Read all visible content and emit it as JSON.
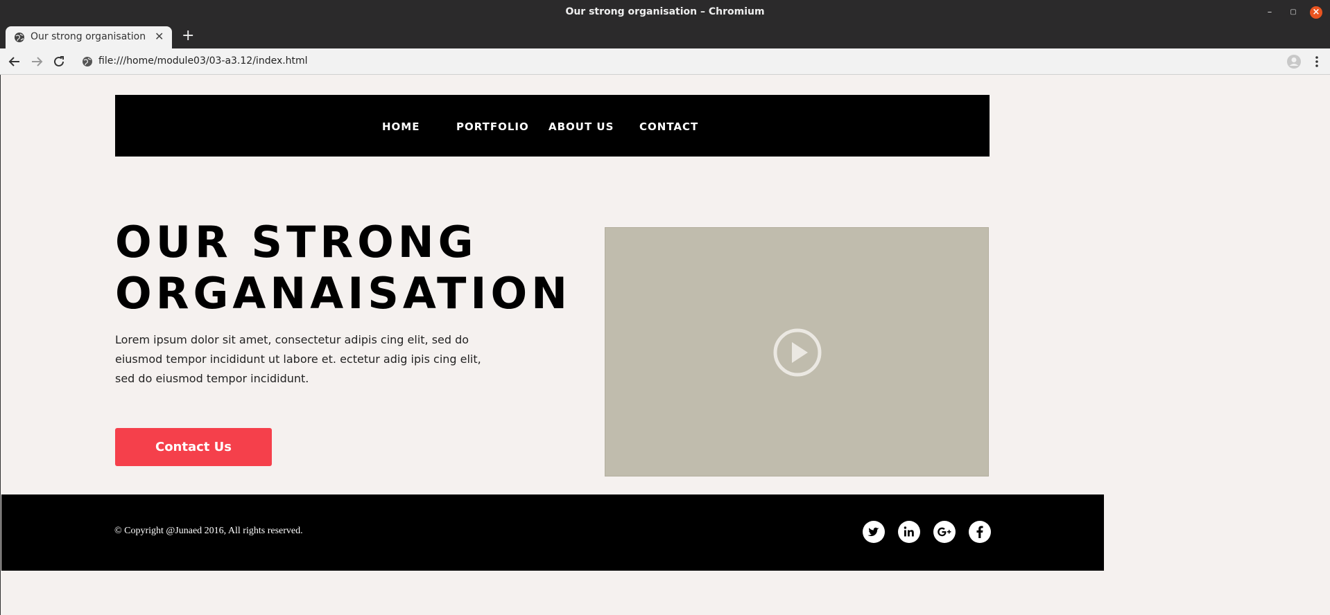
{
  "window": {
    "title": "Our strong organisation – Chromium"
  },
  "tab": {
    "title": "Our strong organisation",
    "close_glyph": "✕",
    "new_tab_glyph": "+"
  },
  "toolbar": {
    "url": "file:///home/module03/03-a3.12/index.html"
  },
  "nav": {
    "items": [
      {
        "label": "HOME"
      },
      {
        "label": "PORTFOLIO"
      },
      {
        "label": "ABOUT US"
      },
      {
        "label": "CONTACT"
      }
    ]
  },
  "hero": {
    "title_line1": "OUR STRONG",
    "title_line2": "ORGANAISATION",
    "text": "Lorem ipsum dolor sit amet, consectetur adipis cing elit, sed do eiusmod tempor incididunt ut labore et. ectetur adig ipis cing elit, sed do eiusmod tempor incididunt.",
    "button_label": "Contact Us"
  },
  "video": {
    "icon": "play-icon",
    "background": "#c0bcad"
  },
  "footer": {
    "copyright": "© Copyright @Junaed 2016, All rights reserved.",
    "social": [
      "twitter-icon",
      "linkedin-icon",
      "google-plus-icon",
      "facebook-icon"
    ]
  },
  "colors": {
    "page_bg": "#f5f1ef",
    "nav_bg": "#000000",
    "button_bg": "#f5404b",
    "footer_bg": "#000000",
    "window_close": "#e95420"
  }
}
